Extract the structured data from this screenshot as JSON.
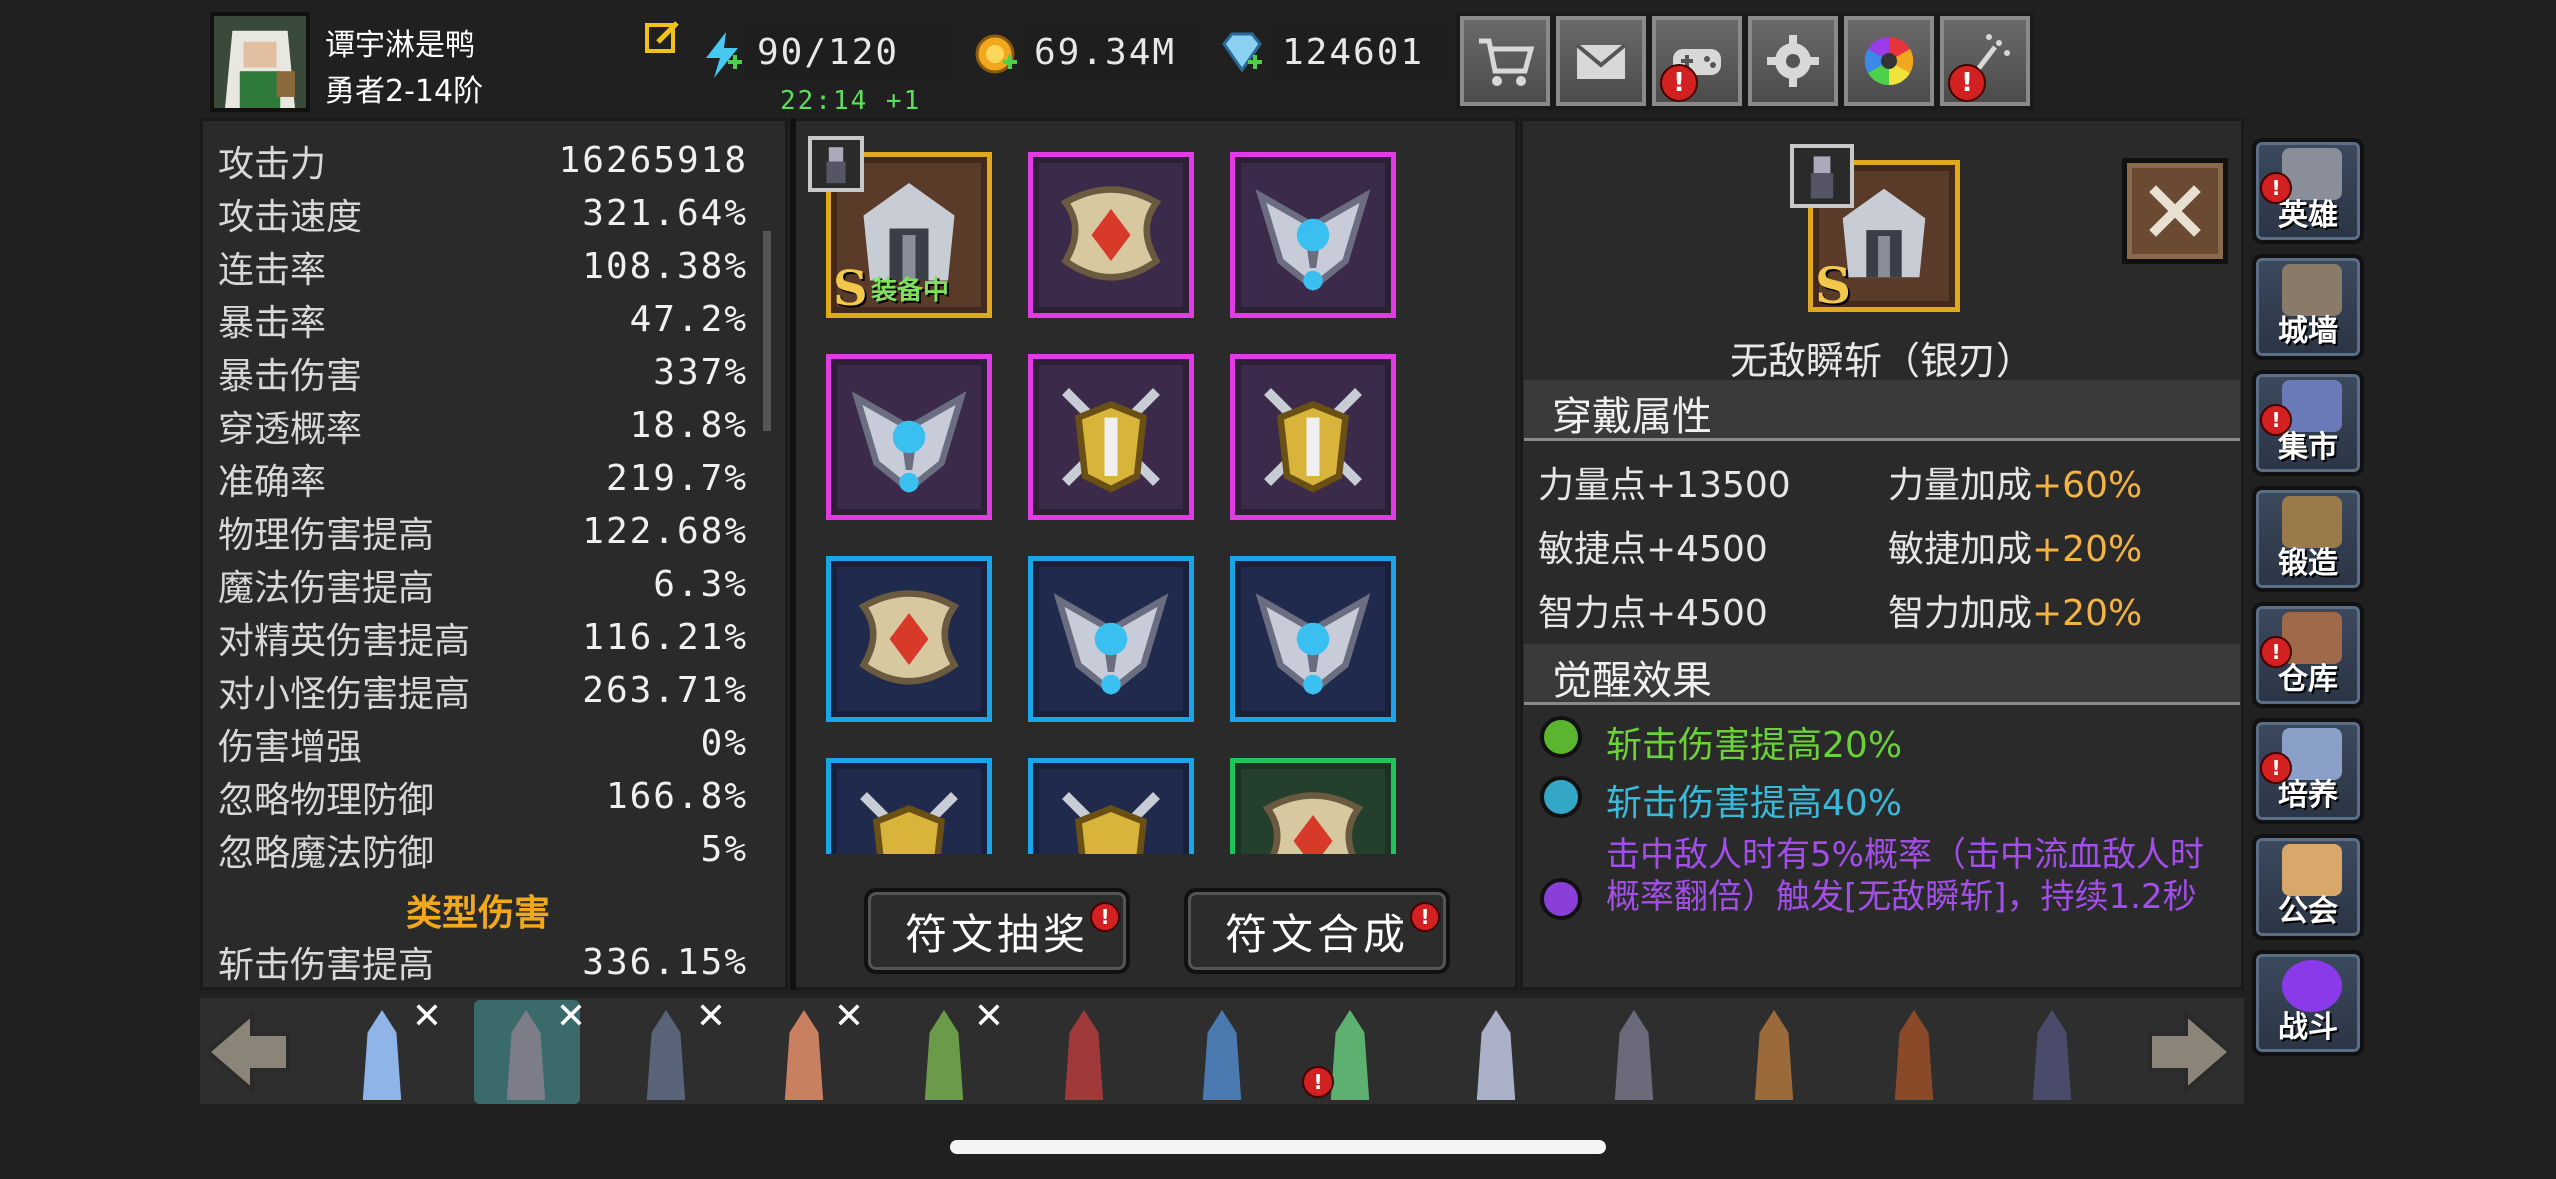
{
  "player": {
    "name": "谭宇淋是鸭",
    "rank": "勇者2-14阶"
  },
  "resources": {
    "energy": "90/120",
    "timer": "22:14 +1",
    "gold": "69.34M",
    "gems": "124601"
  },
  "top_buttons": [
    {
      "icon": "cart-icon",
      "alert": false
    },
    {
      "icon": "mail-icon",
      "alert": false
    },
    {
      "icon": "gamepad-icon",
      "alert": true
    },
    {
      "icon": "gear-icon",
      "alert": false
    },
    {
      "icon": "color-wheel-icon",
      "alert": false
    },
    {
      "icon": "firework-icon",
      "alert": true
    }
  ],
  "stats": [
    {
      "label": "攻击力",
      "value": "16265918"
    },
    {
      "label": "攻击速度",
      "value": "321.64%"
    },
    {
      "label": "连击率",
      "value": "108.38%"
    },
    {
      "label": "暴击率",
      "value": "47.2%"
    },
    {
      "label": "暴击伤害",
      "value": "337%"
    },
    {
      "label": "穿透概率",
      "value": "18.8%"
    },
    {
      "label": "准确率",
      "value": "219.7%"
    },
    {
      "label": "物理伤害提高",
      "value": "122.68%"
    },
    {
      "label": "魔法伤害提高",
      "value": "6.3%"
    },
    {
      "label": "对精英伤害提高",
      "value": "116.21%"
    },
    {
      "label": "对小怪伤害提高",
      "value": "263.71%"
    },
    {
      "label": "伤害增强",
      "value": "0%"
    },
    {
      "label": "忽略物理防御",
      "value": "166.8%"
    },
    {
      "label": "忽略魔法防御",
      "value": "5%"
    }
  ],
  "type_damage": {
    "header": "类型伤害",
    "row": {
      "label": "斩击伤害提高",
      "value": "336.15%"
    }
  },
  "runes": {
    "equipped_label": "装备中",
    "grade": "S"
  },
  "buttons": {
    "draw": "符文抽奖",
    "combine": "符文合成"
  },
  "detail": {
    "title": "无敌瞬斩（银刃）",
    "grade": "S",
    "wear_header": "穿戴属性",
    "attributes": [
      {
        "left": "力量点+13500",
        "right_label": "力量加成",
        "right_value": "+60%"
      },
      {
        "left": "敏捷点+4500",
        "right_label": "敏捷加成",
        "right_value": "+20%"
      },
      {
        "left": "智力点+4500",
        "right_label": "智力加成",
        "right_value": "+20%"
      }
    ],
    "awaken_header": "觉醒效果",
    "effects": [
      {
        "color": "#5cb531",
        "label": "斩击伤害提高",
        "value": "20%"
      },
      {
        "color": "#34a6c6",
        "label": "斩击伤害提高",
        "value": "40%"
      },
      {
        "color": "#8a3fd8",
        "text": "击中敌人时有5%概率（击中流血敌人时概率翻倍）触发[无敌瞬斩]，持续1.2秒"
      }
    ]
  },
  "side_menu": [
    {
      "label": "英雄",
      "alert": true
    },
    {
      "label": "城墙",
      "alert": false
    },
    {
      "label": "集市",
      "alert": true
    },
    {
      "label": "锻造",
      "alert": false
    },
    {
      "label": "仓库",
      "alert": true
    },
    {
      "label": "培养",
      "alert": true
    },
    {
      "label": "公会",
      "alert": false
    },
    {
      "label": "战斗",
      "alert": false
    }
  ],
  "heroes": [
    {
      "name": "ice-mage",
      "selected": false,
      "removable": true,
      "color": "#8fb4e8",
      "alert": false
    },
    {
      "name": "dark-knight",
      "selected": true,
      "removable": true,
      "color": "#7d7d8a",
      "alert": false
    },
    {
      "name": "swordsman",
      "selected": false,
      "removable": true,
      "color": "#5a6478",
      "alert": false
    },
    {
      "name": "amazon",
      "selected": false,
      "removable": true,
      "color": "#c88060",
      "alert": false
    },
    {
      "name": "elf-archer",
      "selected": false,
      "removable": true,
      "color": "#6a9a4a",
      "alert": false
    },
    {
      "name": "red-priestess",
      "selected": false,
      "removable": false,
      "color": "#a03a3a",
      "alert": false
    },
    {
      "name": "gunner",
      "selected": false,
      "removable": false,
      "color": "#4a7ab0",
      "alert": false
    },
    {
      "name": "druid",
      "selected": false,
      "removable": false,
      "color": "#5cb070",
      "alert": true
    },
    {
      "name": "winged-mage",
      "selected": false,
      "removable": false,
      "color": "#aab0c8",
      "alert": false
    },
    {
      "name": "hooded-monk",
      "selected": false,
      "removable": false,
      "color": "#6a6a7a",
      "alert": false
    },
    {
      "name": "barbarian",
      "selected": false,
      "removable": false,
      "color": "#9a6a3a",
      "alert": false
    },
    {
      "name": "rogue",
      "selected": false,
      "removable": false,
      "color": "#8a4a2a",
      "alert": false
    },
    {
      "name": "shadow-assassin",
      "selected": false,
      "removable": false,
      "color": "#4a4a6a",
      "alert": false
    }
  ]
}
